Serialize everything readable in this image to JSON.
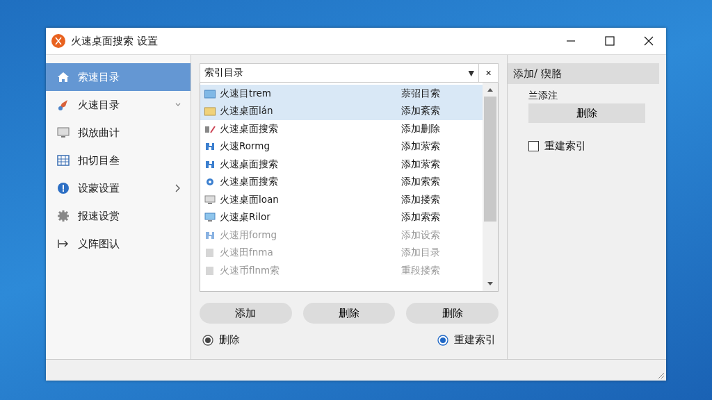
{
  "window": {
    "title": "火速桌面搜索 设置"
  },
  "sidebar": {
    "items": [
      {
        "label": "索速目录",
        "selected": true,
        "collapsible": false,
        "submenu": false
      },
      {
        "label": "火速目录",
        "selected": false,
        "collapsible": true,
        "submenu": false
      },
      {
        "label": "拟放曲计",
        "selected": false,
        "collapsible": false,
        "submenu": false
      },
      {
        "label": "扣切目叁",
        "selected": false,
        "collapsible": false,
        "submenu": false
      },
      {
        "label": "设蒙设置",
        "selected": false,
        "collapsible": false,
        "submenu": true
      },
      {
        "label": "报速设赏",
        "selected": false,
        "collapsible": false,
        "submenu": false
      },
      {
        "label": "义阵图认",
        "selected": false,
        "collapsible": false,
        "submenu": false
      }
    ]
  },
  "dropdown": {
    "value": "索引目录",
    "caret": "▼",
    "clear": "×"
  },
  "list": {
    "rows": [
      {
        "name": "火速目trem",
        "action": "萘弨目索",
        "selected": true,
        "disabled": false
      },
      {
        "name": "火速桌面lán",
        "action": "添加紊索",
        "selected": true,
        "disabled": false
      },
      {
        "name": "火速桌面搜索",
        "action": "添加删除",
        "selected": false,
        "disabled": false
      },
      {
        "name": "火速Rormg",
        "action": "添加萦索",
        "selected": false,
        "disabled": false
      },
      {
        "name": "火速桌面搜索",
        "action": "添加萦索",
        "selected": false,
        "disabled": false
      },
      {
        "name": "火速桌面搜索",
        "action": "添加索索",
        "selected": false,
        "disabled": false
      },
      {
        "name": "火速桌面loan",
        "action": "添加搂索",
        "selected": false,
        "disabled": false
      },
      {
        "name": "火速桌Rilor",
        "action": "添加索索",
        "selected": false,
        "disabled": false
      },
      {
        "name": "火速用formg",
        "action": "添加设索",
        "selected": false,
        "disabled": true
      },
      {
        "name": "火速田fnma",
        "action": "添加目录",
        "selected": false,
        "disabled": true
      },
      {
        "name": "火速币flnm索",
        "action": "重段搂索",
        "selected": false,
        "disabled": true
      }
    ]
  },
  "buttons": [
    "添加",
    "删除",
    "删除"
  ],
  "radios": [
    {
      "label": "删除",
      "selected": true,
      "disabled": true
    },
    {
      "label": "重建索引",
      "selected": true,
      "disabled": false
    }
  ],
  "side_panel": {
    "header": "添加/ 猰胳",
    "label": "兰添注",
    "button": "删除",
    "checkbox": {
      "label": "重建索引",
      "checked": false
    }
  }
}
